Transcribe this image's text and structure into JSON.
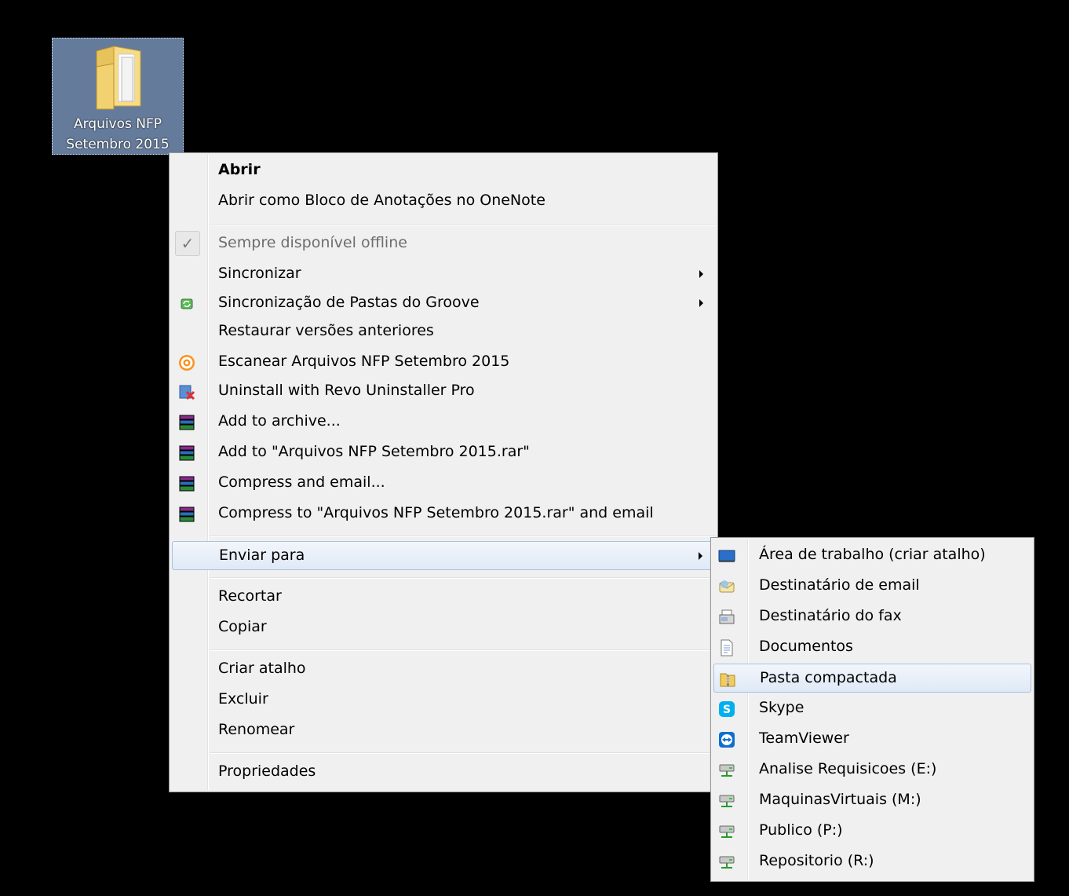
{
  "desktop_icon": {
    "line1": "Arquivos NFP",
    "line2": "Setembro 2015"
  },
  "context_menu": {
    "items": [
      {
        "label": "Abrir"
      },
      {
        "label": "Abrir como Bloco de Anotações no OneNote"
      },
      {
        "label": "Sempre disponível offline",
        "check": "✓"
      },
      {
        "label": "Sincronizar"
      },
      {
        "label": "Sincronização de Pastas do Groove"
      },
      {
        "label": "Restaurar versões anteriores"
      },
      {
        "label": "Escanear Arquivos NFP Setembro 2015"
      },
      {
        "label": "Uninstall with Revo Uninstaller Pro"
      },
      {
        "label": "Add to archive..."
      },
      {
        "label": "Add to \"Arquivos NFP Setembro 2015.rar\""
      },
      {
        "label": "Compress and email..."
      },
      {
        "label": "Compress to \"Arquivos NFP Setembro 2015.rar\" and email"
      },
      {
        "label": "Enviar para"
      },
      {
        "label": "Recortar"
      },
      {
        "label": "Copiar"
      },
      {
        "label": "Criar atalho"
      },
      {
        "label": "Excluir"
      },
      {
        "label": "Renomear"
      },
      {
        "label": "Propriedades"
      }
    ]
  },
  "sendto_menu": {
    "items": [
      {
        "label": "Área de trabalho (criar atalho)"
      },
      {
        "label": "Destinatário de email"
      },
      {
        "label": "Destinatário do fax"
      },
      {
        "label": "Documentos"
      },
      {
        "label": "Pasta compactada"
      },
      {
        "label": "Skype"
      },
      {
        "label": "TeamViewer"
      },
      {
        "label": "Analise Requisicoes (E:)"
      },
      {
        "label": "MaquinasVirtuais (M:)"
      },
      {
        "label": "Publico (P:)"
      },
      {
        "label": "Repositorio (R:)"
      }
    ]
  },
  "colors": {
    "desktop": "#000000",
    "menu_bg": "#f0f0f0",
    "hover_border": "#a8c2e0"
  }
}
